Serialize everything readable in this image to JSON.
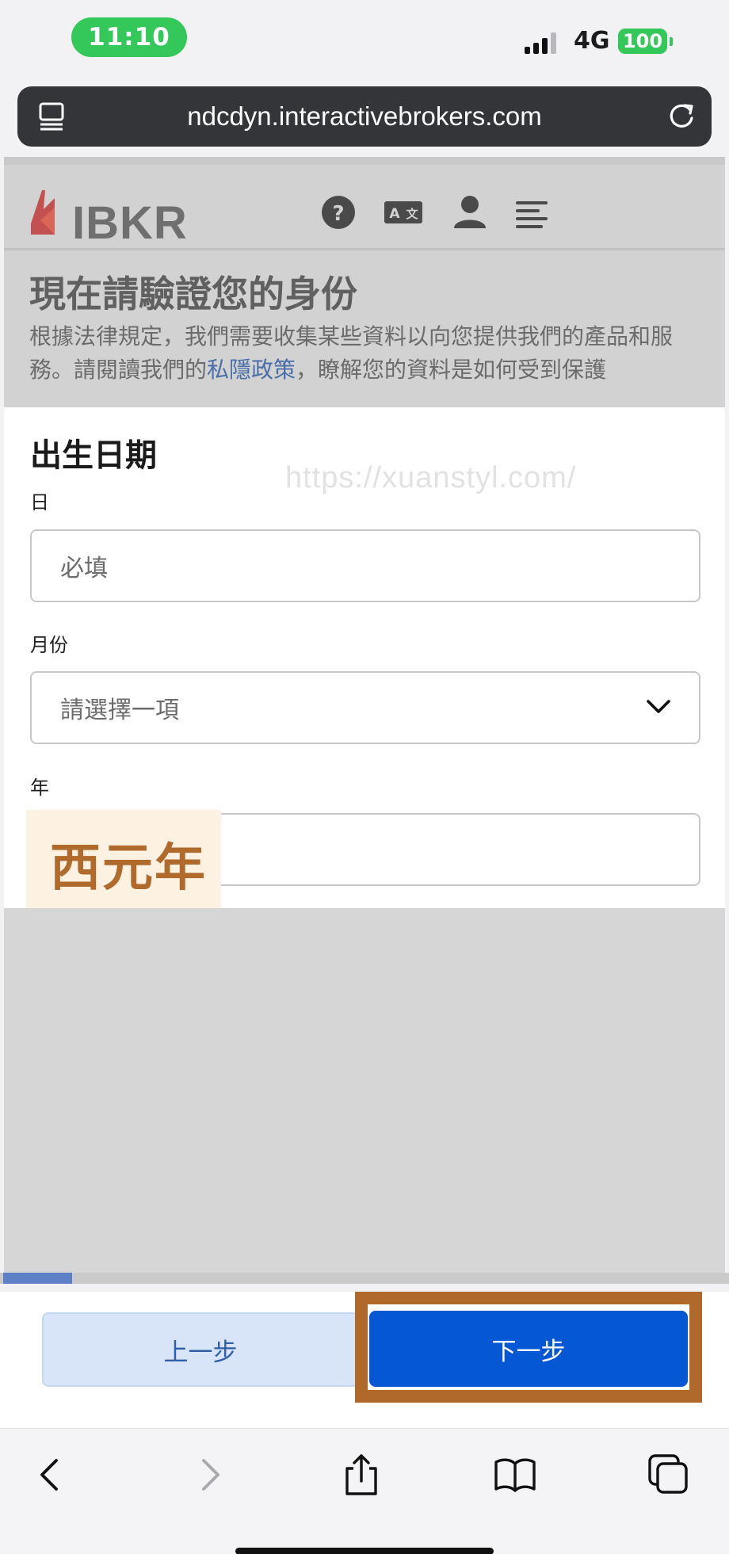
{
  "status_bar": {
    "time": "11:10",
    "network": "4G",
    "battery": "100"
  },
  "browser": {
    "url": "ndcdyn.interactivebrokers.com"
  },
  "site": {
    "logo_text": "IBKR"
  },
  "verify": {
    "title": "現在請驗證您的身份",
    "desc_before": "根據法律規定，我們需要收集某些資料以向您提供我們的產品和服務。請閱讀我們的",
    "desc_link": "私隱政策",
    "desc_after": "，瞭解您的資料是如何受到保護"
  },
  "form": {
    "section_title": "出生日期",
    "watermark": "https://xuanstyl.com/",
    "day_label": "日",
    "day_placeholder": "必填",
    "month_label": "月份",
    "month_value": "請選擇一項",
    "year_label": "年",
    "year_annotation": "西元年"
  },
  "progress": {
    "fraction": 0.095
  },
  "buttons": {
    "prev": "上一步",
    "next": "下一步"
  },
  "colors": {
    "primary": "#0557d4",
    "highlight": "#b1692b",
    "status_green": "#34c759"
  },
  "icons": [
    "tabs-icon",
    "reload-icon",
    "help-icon",
    "translate-icon",
    "user-icon",
    "menu-icon",
    "back-icon",
    "forward-icon",
    "share-icon",
    "bookmarks-icon",
    "tabs-overview-icon"
  ]
}
